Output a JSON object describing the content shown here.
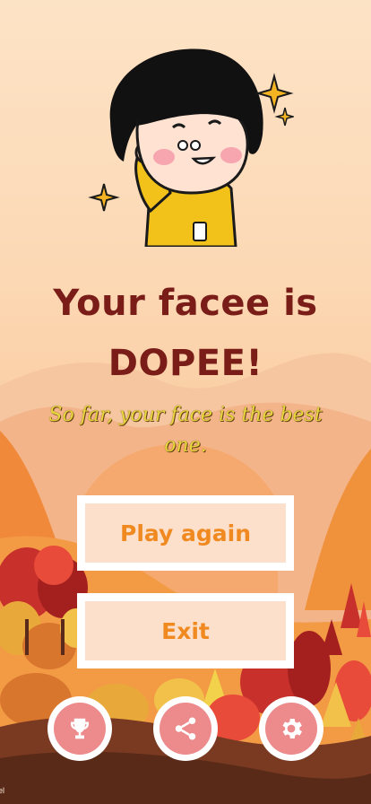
{
  "result": {
    "headline_line1": "Your facee is",
    "headline_line2": "DOPEE!",
    "subtitle": "So far, your face is the best one."
  },
  "buttons": {
    "play_again": "Play again",
    "exit": "Exit"
  },
  "bottom_bar": {
    "icons": [
      "trophy-icon",
      "share-icon",
      "gear-icon"
    ]
  },
  "watermark": "el",
  "colors": {
    "headline": "#7a1d18",
    "subtitle": "#e8d63d",
    "button_text": "#f08a20",
    "button_fill": "#fde0cc",
    "icon_circle": "#ec8a8c"
  }
}
